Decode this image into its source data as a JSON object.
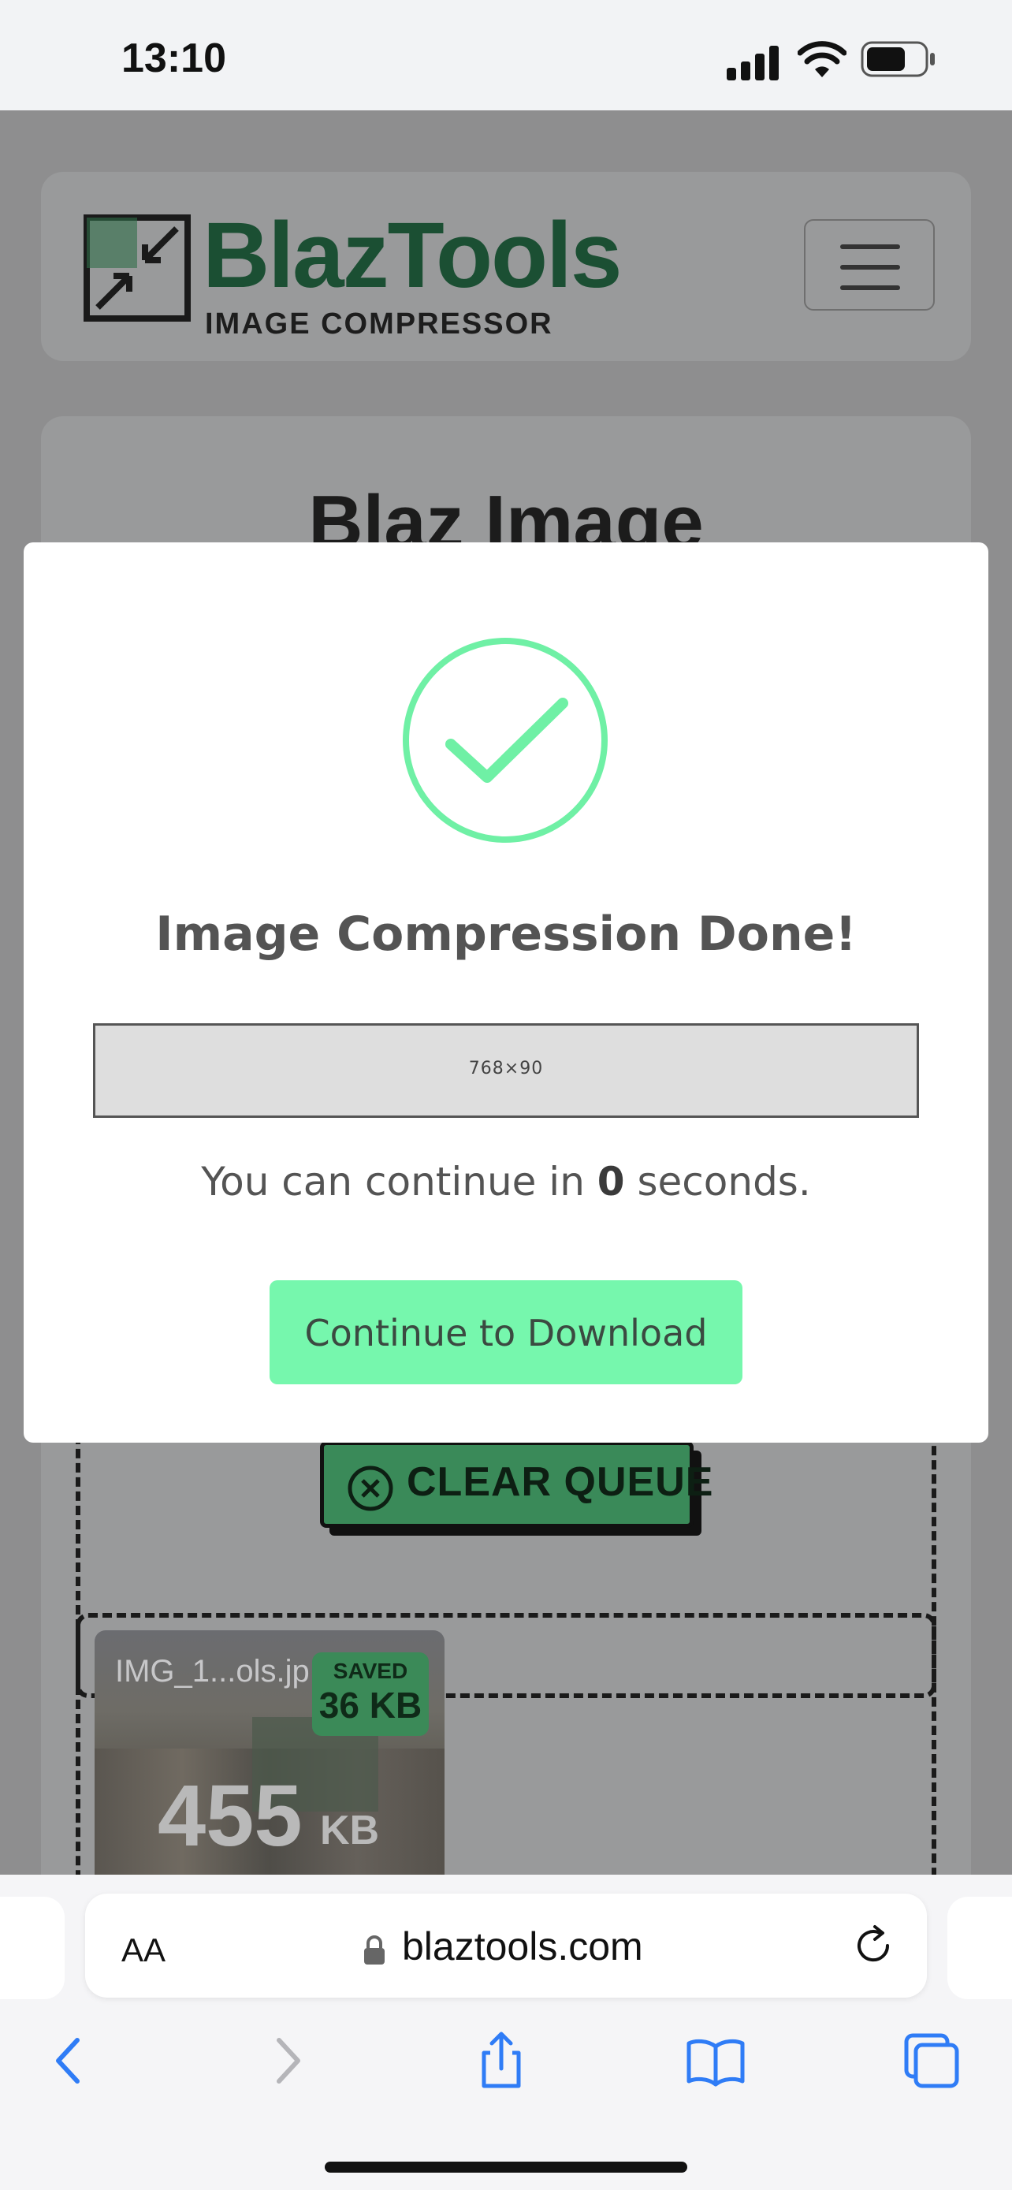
{
  "status_bar": {
    "time": "13:10"
  },
  "site": {
    "brand": "BlazTools",
    "brand_sub": "IMAGE COMPRESSOR",
    "page_title_partial": "Blaz Image",
    "queue": {
      "clear_label": "CLEAR QUEUE"
    },
    "file_card": {
      "filename": "IMG_1...ols.jp",
      "saved_label": "SAVED",
      "saved_value": "36 KB",
      "size_value": "455",
      "size_unit": "KB"
    }
  },
  "modal": {
    "icon": "check-circle-icon",
    "title": "Image Compression Done!",
    "ad_placeholder": "768×90",
    "countdown_prefix": "You can continue in ",
    "countdown_value": "0",
    "countdown_suffix": " seconds.",
    "continue_button": "Continue to Download"
  },
  "browser": {
    "text_size_label": "AA",
    "url": "blaztools.com",
    "toolbar": [
      "back-icon",
      "forward-icon",
      "share-icon",
      "bookmarks-icon",
      "tabs-icon"
    ]
  },
  "colors": {
    "accent_green": "#76f7ad",
    "check_green": "#6ff0a5",
    "brand_green": "#3fbf73"
  }
}
